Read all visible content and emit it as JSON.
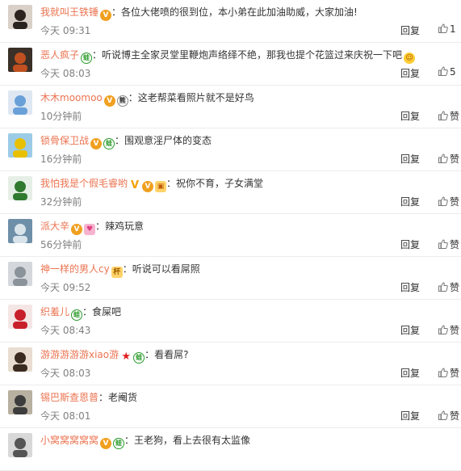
{
  "comments": [
    {
      "user": "我就叫王铁锤",
      "badges": [
        "vip"
      ],
      "text": "：各位大佬喷的很到位，本小弟在此加油助威，大家加油!",
      "time": "今天 09:31",
      "reply": "回复",
      "like": "1"
    },
    {
      "user": "恶人疯子",
      "badges": [
        "frog"
      ],
      "text": "：听说博主全家灵堂里鞭炮声络绎不绝，那我也提个花篮过来庆祝一下吧",
      "trailing_badge": "emoji",
      "time": "今天 08:03",
      "reply": "回复",
      "like": "5"
    },
    {
      "user": "木木moomoo",
      "badges": [
        "vip",
        "bear"
      ],
      "text": "：这老帮菜看照片就不是好鸟",
      "time": "10分钟前",
      "reply": "回复",
      "like": "赞"
    },
    {
      "user": "锁骨保卫战",
      "badges": [
        "vip",
        "frog"
      ],
      "text": "：围观意淫尸体的变态",
      "time": "16分钟前",
      "reply": "回复",
      "like": "赞"
    },
    {
      "user": "我怕我是个假毛睿哟",
      "badges": [
        "v",
        "vip",
        "pic"
      ],
      "text": "：祝你不育，子女满堂",
      "time": "32分钟前",
      "reply": "回复",
      "like": "赞"
    },
    {
      "user": "派大辛",
      "badges": [
        "vip",
        "heart"
      ],
      "text": "：辣鸡玩意",
      "time": "56分钟前",
      "reply": "回复",
      "like": "赞"
    },
    {
      "user": "神一样的男人cy",
      "badges": [
        "cup"
      ],
      "text": "：听说可以看屌照",
      "time": "今天 09:52",
      "reply": "回复",
      "like": "赞"
    },
    {
      "user": "织羞儿",
      "badges": [
        "frog"
      ],
      "text": "：食屎吧",
      "time": "今天 08:43",
      "reply": "回复",
      "like": "赞"
    },
    {
      "user": "游游游游游xiao游",
      "badges": [
        "star",
        "frog"
      ],
      "text": "：看看屌?",
      "time": "今天 08:03",
      "reply": "回复",
      "like": "赞"
    },
    {
      "user": "锡巴斯查恩普",
      "badges": [],
      "text": "：老阉货",
      "time": "今天 08:01",
      "reply": "回复",
      "like": "赞"
    },
    {
      "user": "小窝窝窝窝窝",
      "badges": [
        "vip",
        "frog"
      ],
      "text": "：王老狗，看上去很有太监像",
      "time": "",
      "reply": "",
      "like": ""
    }
  ],
  "colors": {
    "username": "#eb7350",
    "time": "#808080",
    "text": "#333333",
    "divider": "#ececec"
  },
  "icons": {
    "like": "thumb-up-icon"
  }
}
